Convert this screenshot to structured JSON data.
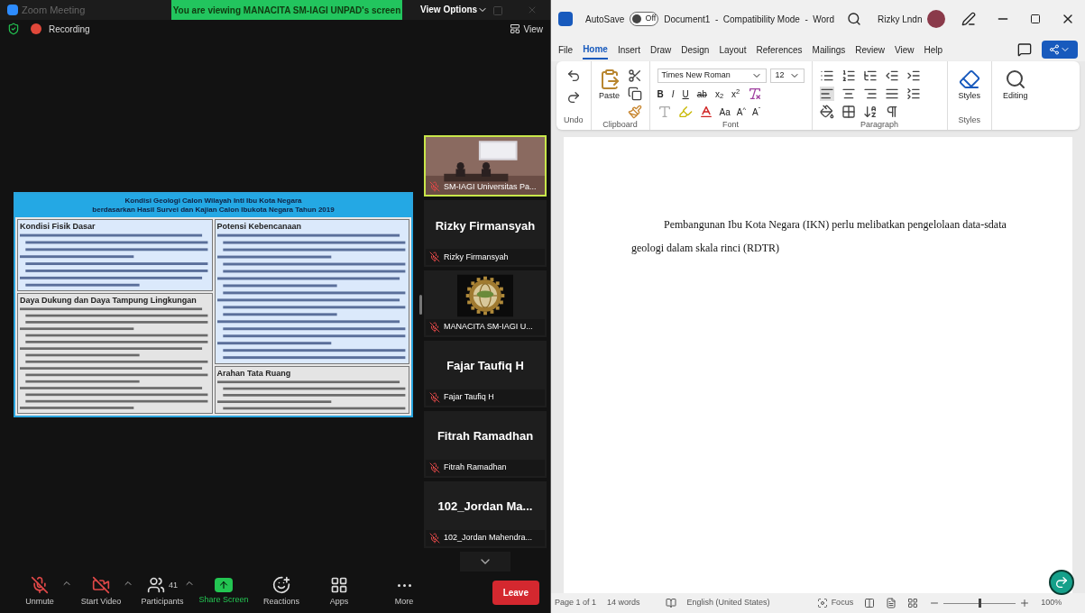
{
  "zoom": {
    "title": "Zoom Meeting",
    "banner": "You are viewing MANACITA SM-IAGI UNPAD's screen",
    "view_options": "View Options",
    "recording": "Recording",
    "view": "View",
    "slide": {
      "title_lines": [
        "Kondisi Geologi Calon Wilayah Inti Ibu Kota Negara",
        "berdasarkan Hasil Survei dan Kajian Calon Ibukota Negara Tahun 2019"
      ],
      "sections": [
        {
          "heading": "Kondisi Fisik Dasar",
          "kind": "highlighted"
        },
        {
          "heading": "Potensi Kebencanaan",
          "kind": "highlighted"
        },
        {
          "heading": "Daya Dukung dan Daya Tampung Lingkungan",
          "kind": "plain"
        },
        {
          "heading": "Arahan Tata Ruang",
          "kind": "plain"
        }
      ]
    },
    "participants": [
      {
        "kind": "video",
        "label": "SM-IAGI Universitas Pa...",
        "selected": true
      },
      {
        "kind": "name",
        "name": "Rizky Firmansyah",
        "label": "Rizky Firmansyah",
        "selected": false
      },
      {
        "kind": "logo",
        "label": "MANACITA SM-IAGI U...",
        "selected": false
      },
      {
        "kind": "name",
        "name": "Fajar Taufiq H",
        "label": "Fajar Taufiq H",
        "selected": false
      },
      {
        "kind": "name",
        "name": "Fitrah Ramadhan",
        "label": "Fitrah Ramadhan",
        "selected": false
      },
      {
        "kind": "name",
        "name": "102_Jordan  Ma...",
        "label": "102_Jordan Mahendra...",
        "selected": false
      }
    ],
    "toolbar": [
      {
        "kind": "mic",
        "label": "Unmute"
      },
      {
        "kind": "video",
        "label": "Start Video"
      },
      {
        "kind": "participants",
        "label": "Participants",
        "count": "41"
      },
      {
        "kind": "share",
        "label": "Share Screen"
      },
      {
        "kind": "reactions",
        "label": "Reactions"
      },
      {
        "kind": "apps",
        "label": "Apps"
      },
      {
        "kind": "more",
        "label": "More"
      }
    ],
    "leave": "Leave"
  },
  "word": {
    "autosave": "AutoSave",
    "autosave_toggle": {
      "label": "Off",
      "on": false
    },
    "title": "Document1  -  Compatibility Mode  -  Word",
    "user": "Rizky Lndn",
    "tabs": [
      {
        "label": "File",
        "selected": false
      },
      {
        "label": "Home",
        "selected": true
      },
      {
        "label": "Insert",
        "selected": false
      },
      {
        "label": "Draw",
        "selected": false
      },
      {
        "label": "Design",
        "selected": false
      },
      {
        "label": "Layout",
        "selected": false
      },
      {
        "label": "References",
        "selected": false
      },
      {
        "label": "Mailings",
        "selected": false
      },
      {
        "label": "Review",
        "selected": false
      },
      {
        "label": "View",
        "selected": false
      },
      {
        "label": "Help",
        "selected": false
      }
    ],
    "ribbon": {
      "font": "Times New Roman",
      "size": "12",
      "paste": "Paste",
      "format_buttons": [
        "B",
        "I",
        "U",
        "ab",
        "x$_{2}$",
        "x$^{2}$"
      ],
      "case_button": "Aa",
      "grow_buttons": [
        "A$^{^}$",
        "A$^{ˇ}$"
      ],
      "styles": "Styles",
      "editing": "Editing",
      "groups": [
        "Undo",
        "Clipboard",
        "Font",
        "Paragraph",
        "Styles"
      ]
    },
    "document": {
      "paragraph": "Pembangunan Ibu Kota Negara (IKN) perlu melibatkan pengelolaan data-sdata geologi dalam skala rinci (RDTR)"
    },
    "status": {
      "page": "Page 1 of 1",
      "words": "14 words",
      "language": "English (United States)",
      "focus": "Focus",
      "zoom": "100%",
      "zoom_level": {
        "level": 0.5
      }
    }
  }
}
